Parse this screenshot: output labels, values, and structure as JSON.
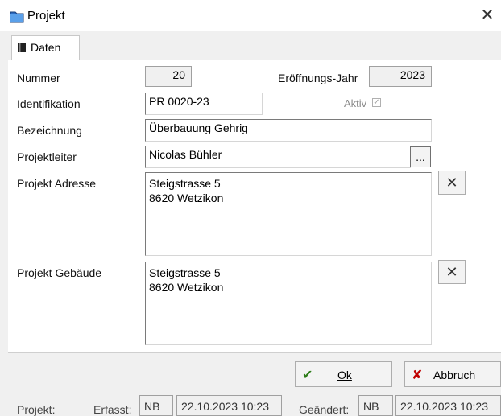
{
  "window": {
    "title": "Projekt",
    "close_glyph": "✕"
  },
  "tabs": [
    {
      "label": "Daten",
      "icon": "book-icon"
    }
  ],
  "form": {
    "nummer": {
      "label": "Nummer",
      "value": "20"
    },
    "eroeffnungsjahr": {
      "label": "Eröffnungs-Jahr",
      "value": "2023"
    },
    "identifikation": {
      "label": "Identifikation",
      "value": "PR 0020-23"
    },
    "aktiv": {
      "label": "Aktiv",
      "checked": true,
      "glyph": "✓"
    },
    "bezeichnung": {
      "label": "Bezeichnung",
      "value": "Überbauung Gehrig"
    },
    "projektleiter": {
      "label": "Projektleiter",
      "value": "Nicolas Bühler",
      "browse_label": "..."
    },
    "projekt_adresse": {
      "label": "Projekt Adresse",
      "value": "Steigstrasse 5\n8620 Wetzikon",
      "clear_glyph": "✕"
    },
    "projekt_gebaeude": {
      "label": "Projekt Gebäude",
      "value": "Steigstrasse 5\n8620 Wetzikon",
      "clear_glyph": "✕"
    }
  },
  "buttons": {
    "ok": {
      "label": "Ok",
      "icon": "checkmark-icon",
      "glyph": "✔",
      "color": "#2e7d1a"
    },
    "abbruch": {
      "label": "Abbruch",
      "icon": "red-x-icon",
      "glyph": "✘",
      "color": "#c00000"
    }
  },
  "status": {
    "projekt_label": "Projekt:",
    "erfasst_label": "Erfasst:",
    "erfasst_user": "NB",
    "erfasst_date": "22.10.2023 10:23",
    "geaendert_label": "Geändert:",
    "geaendert_user": "NB",
    "geaendert_date": "22.10.2023 10:23"
  }
}
